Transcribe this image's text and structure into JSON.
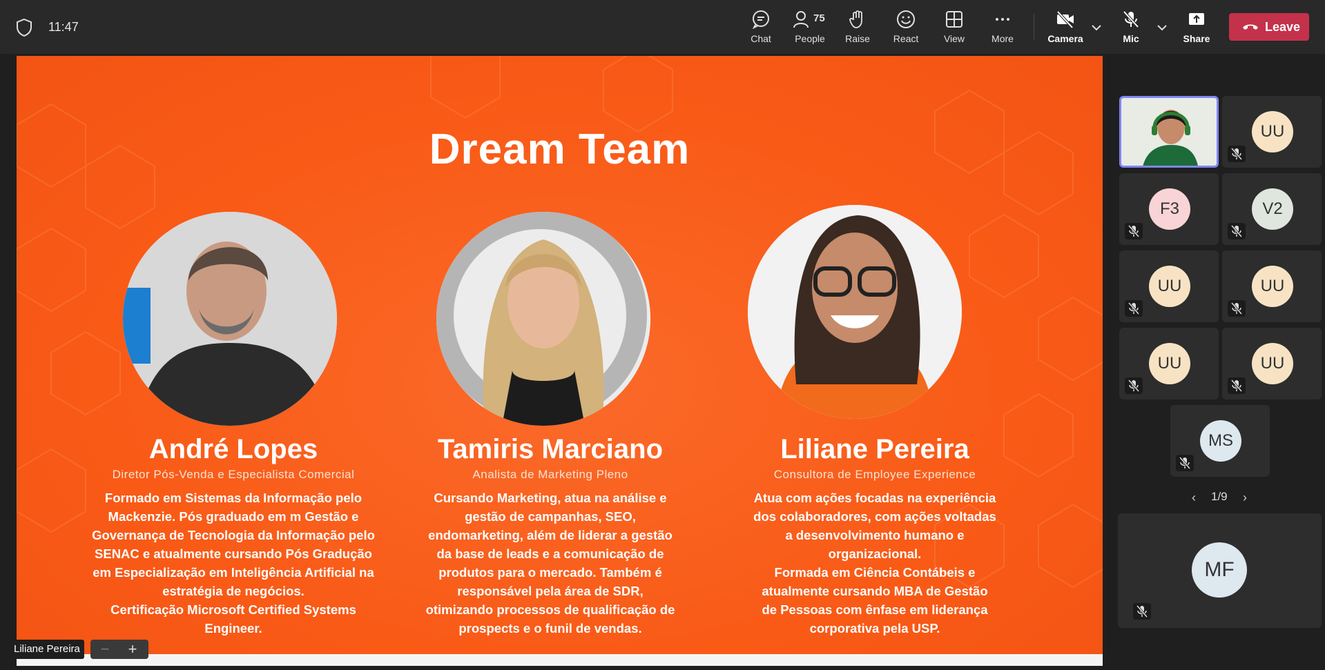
{
  "clock": "11:47",
  "toolbar": {
    "chat": "Chat",
    "people": "People",
    "people_count": "75",
    "raise": "Raise",
    "react": "React",
    "view": "View",
    "more": "More",
    "camera": "Camera",
    "mic": "Mic",
    "share": "Share",
    "leave": "Leave"
  },
  "slide": {
    "title": "Dream Team",
    "people": [
      {
        "name": "André Lopes",
        "role": "Diretor Pós-Venda e Especialista Comercial",
        "bio": "Formado em Sistemas da Informação pelo\nMackenzie. Pós graduado em m Gestão e\nGovernança de Tecnologia da Informação pelo\nSENAC e atualmente cursando Pós Gradução\nem  Especialização em Inteligência Artificial na\nestratégia de negócios.\nCertificação Microsoft Certified Systems\nEngineer."
      },
      {
        "name": "Tamiris Marciano",
        "role": "Analista de Marketing Pleno",
        "bio": "Cursando Marketing, atua  na análise e\ngestão de campanhas, SEO,\nendomarketing, além de liderar a gestão\nda base de leads e a comunicação de\nprodutos para o mercado. Também é\nresponsável pela área de SDR,\notimizando processos de qualificação de\nprospects e o funil de vendas."
      },
      {
        "name": "Liliane Pereira",
        "role": "Consultora de Employee Experience",
        "bio": "Atua com ações focadas na experiência\ndos colaboradores, com ações voltadas\na desenvolvimento humano e\norganizacional.\nFormada em Ciência Contábeis e\natualmente cursando MBA  de Gestão\nde Pessoas com ênfase em liderança\ncorporativa pela USP."
      }
    ]
  },
  "presenter_label": "Liliane Pereira",
  "zoom": {
    "minus": "−",
    "plus": "+"
  },
  "participants": [
    {
      "initials": "UU",
      "color": "#f7e3c4"
    },
    {
      "initials": "F3",
      "color": "#f9d4d6"
    },
    {
      "initials": "V2",
      "color": "#dfe6dd"
    },
    {
      "initials": "UU",
      "color": "#f7e3c4"
    },
    {
      "initials": "UU",
      "color": "#f7e3c4"
    },
    {
      "initials": "UU",
      "color": "#f7e3c4"
    },
    {
      "initials": "UU",
      "color": "#f7e3c4"
    },
    {
      "initials": "MS",
      "color": "#dde8ef"
    }
  ],
  "pager": {
    "label": "1/9",
    "prev": "‹",
    "next": "›"
  },
  "pinned_participant": {
    "initials": "MF",
    "color": "#dde8ef"
  },
  "colors": {
    "leave": "#c4314b",
    "slide": "#f95a16",
    "self_border": "#7f85f5"
  }
}
